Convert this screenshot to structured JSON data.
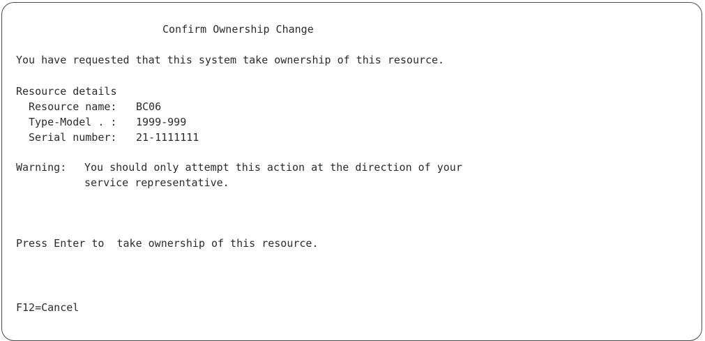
{
  "screen": {
    "title": "Confirm Ownership Change",
    "message": "You have requested that this system take ownership of this resource.",
    "details_heading": "Resource details",
    "details": [
      {
        "label": "Resource name:",
        "value": "BC06"
      },
      {
        "label": "Type-Model . :",
        "value": "1999-999"
      },
      {
        "label": "Serial number:",
        "value": "21-1111111"
      }
    ],
    "warning_label": "Warning:",
    "warning_line1": "You should only attempt this action at the direction of your",
    "warning_line2": "service representative.",
    "instruction": "Press Enter to  take ownership of this resource.",
    "function_keys": [
      {
        "label": "F12=Cancel"
      }
    ]
  }
}
